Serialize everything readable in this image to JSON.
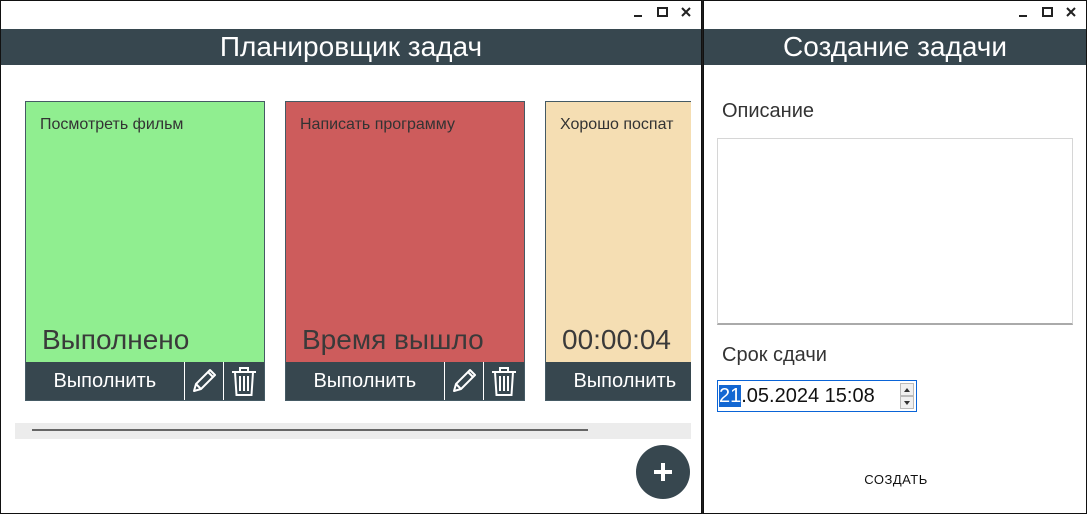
{
  "main_window": {
    "header_title": "Планировщик задач",
    "cards": [
      {
        "title": "Посмотреть фильм",
        "status": "Выполнено",
        "color": "#90ee90",
        "complete_label": "Выполнить"
      },
      {
        "title": "Написать программу",
        "status": "Время вышло",
        "color": "#cd5c5c",
        "complete_label": "Выполнить"
      },
      {
        "title": "Хорошо поспат",
        "status": "00:00:04",
        "color": "#f5deb3",
        "complete_label": "Выполнить"
      }
    ],
    "fab_label": "+"
  },
  "create_window": {
    "header_title": "Создание задачи",
    "description_label": "Описание",
    "description_value": "",
    "deadline_label": "Срок сдачи",
    "deadline_selected_part": "21",
    "deadline_rest": ".05.2024 15:08",
    "create_button_label": "СОЗДАТЬ"
  },
  "colors": {
    "header_bg": "#37474f",
    "selection": "#1367d2"
  }
}
